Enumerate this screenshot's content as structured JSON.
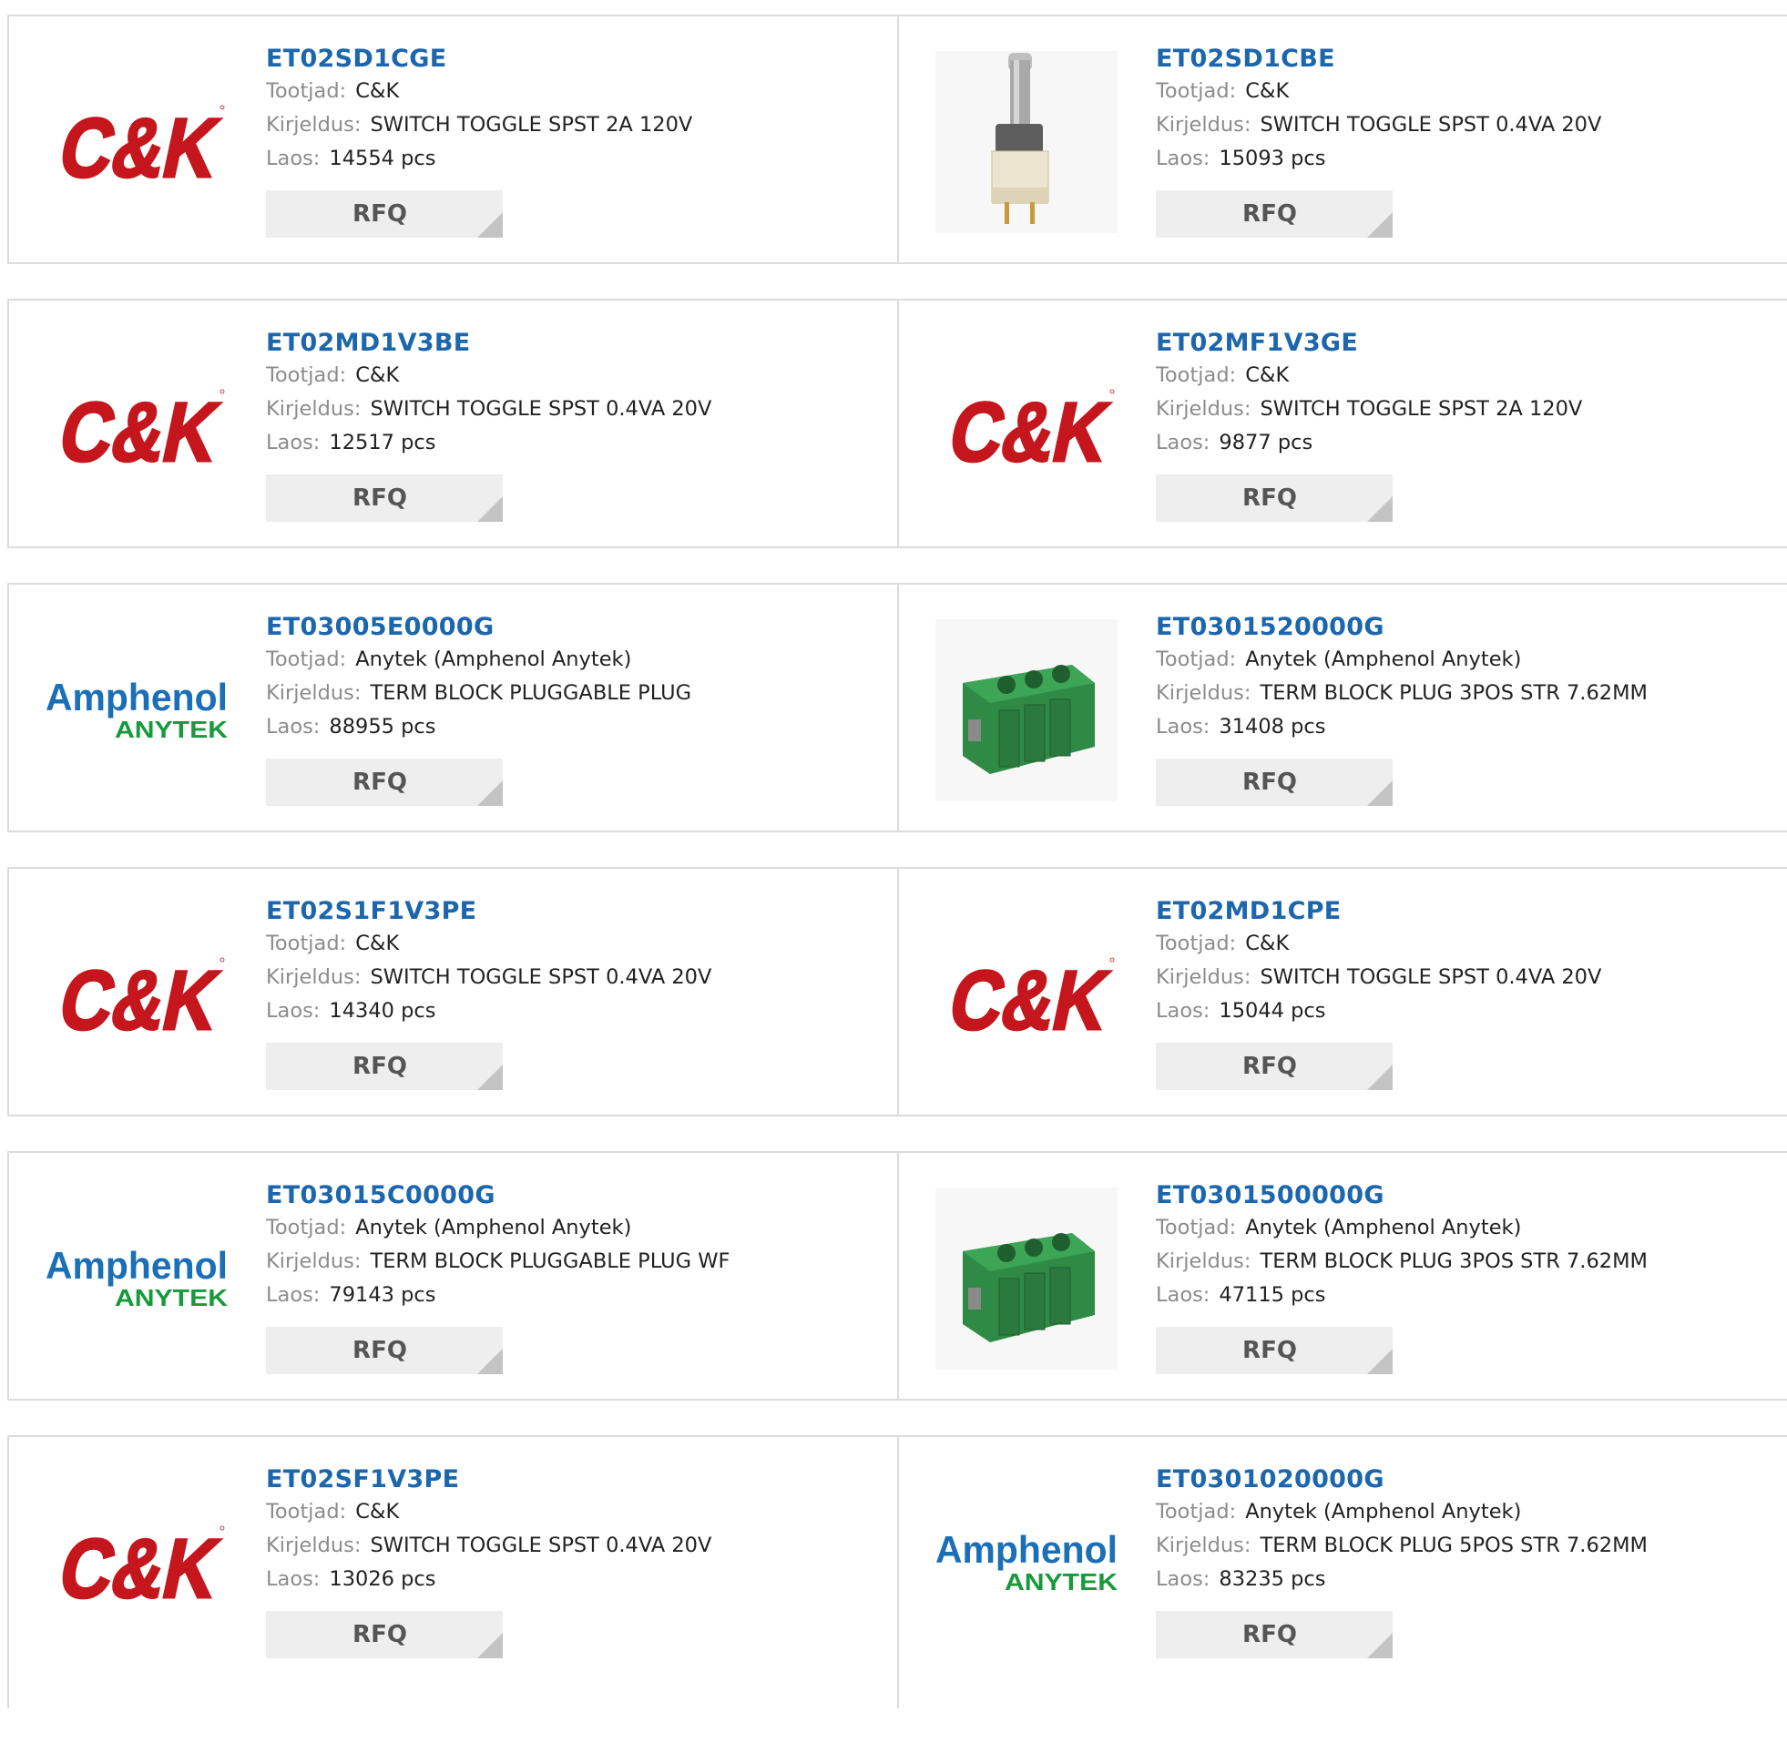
{
  "labels": {
    "manufacturer": "Tootjad:",
    "description": "Kirjeldus:",
    "stock": "Laos:",
    "rfq": "RFQ"
  },
  "products": [
    {
      "pn": "ET02SD1CGE",
      "manufacturer": "C&K",
      "description": "SWITCH TOGGLE SPST 2A 120V",
      "stock": "14554 pcs",
      "image": "ck-logo"
    },
    {
      "pn": "ET02SD1CBE",
      "manufacturer": "C&K",
      "description": "SWITCH TOGGLE SPST 0.4VA 20V",
      "stock": "15093 pcs",
      "image": "toggle-switch-photo"
    },
    {
      "pn": "ET02MD1V3BE",
      "manufacturer": "C&K",
      "description": "SWITCH TOGGLE SPST 0.4VA 20V",
      "stock": "12517 pcs",
      "image": "ck-logo"
    },
    {
      "pn": "ET02MF1V3GE",
      "manufacturer": "C&K",
      "description": "SWITCH TOGGLE SPST 2A 120V",
      "stock": "9877 pcs",
      "image": "ck-logo"
    },
    {
      "pn": "ET03005E0000G",
      "manufacturer": "Anytek (Amphenol Anytek)",
      "description": "TERM BLOCK PLUGGABLE PLUG",
      "stock": "88955 pcs",
      "image": "amphenol-logo"
    },
    {
      "pn": "ET0301520000G",
      "manufacturer": "Anytek (Amphenol Anytek)",
      "description": "TERM BLOCK PLUG 3POS STR 7.62MM",
      "stock": "31408 pcs",
      "image": "terminal-block-photo"
    },
    {
      "pn": "ET02S1F1V3PE",
      "manufacturer": "C&K",
      "description": "SWITCH TOGGLE SPST 0.4VA 20V",
      "stock": "14340 pcs",
      "image": "ck-logo"
    },
    {
      "pn": "ET02MD1CPE",
      "manufacturer": "C&K",
      "description": "SWITCH TOGGLE SPST 0.4VA 20V",
      "stock": "15044 pcs",
      "image": "ck-logo"
    },
    {
      "pn": "ET03015C0000G",
      "manufacturer": "Anytek (Amphenol Anytek)",
      "description": "TERM BLOCK PLUGGABLE PLUG WF",
      "stock": "79143 pcs",
      "image": "amphenol-logo"
    },
    {
      "pn": "ET0301500000G",
      "manufacturer": "Anytek (Amphenol Anytek)",
      "description": "TERM BLOCK PLUG 3POS STR 7.62MM",
      "stock": "47115 pcs",
      "image": "terminal-block-photo"
    },
    {
      "pn": "ET02SF1V3PE",
      "manufacturer": "C&K",
      "description": "SWITCH TOGGLE SPST 0.4VA 20V",
      "stock": "13026 pcs",
      "image": "ck-logo"
    },
    {
      "pn": "ET0301020000G",
      "manufacturer": "Anytek (Amphenol Anytek)",
      "description": "TERM BLOCK PLUG 5POS STR 7.62MM",
      "stock": "83235 pcs",
      "image": "amphenol-logo"
    }
  ],
  "logos": {
    "ck": {
      "text": "C&K",
      "color": "#c4161c"
    },
    "amphenol": {
      "top": "Amphenol",
      "bottom": "ANYTEK",
      "top_color": "#1b6fb6",
      "bottom_color": "#169a3a"
    }
  }
}
